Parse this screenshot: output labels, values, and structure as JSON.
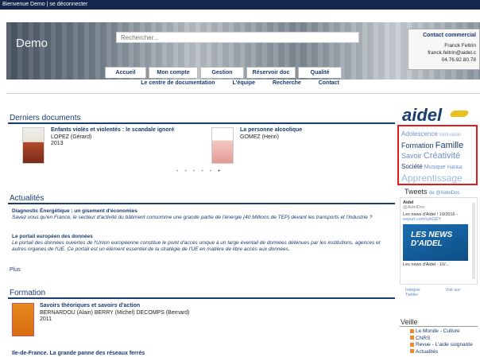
{
  "topbar": {
    "text": "Bienvenue Demo | se déconnecter"
  },
  "header": {
    "brand": "Demo",
    "search_placeholder": "Rechercher...",
    "contact": {
      "title": "Contact commercial",
      "name": "Franck Feltrin",
      "email": "franck.feltrin@aidel.c",
      "phone": "04.76.92.80.78"
    }
  },
  "nav": {
    "tabs": [
      "Accueil",
      "Mon compte",
      "Gestion",
      "Réservoir doc",
      "Qualité"
    ],
    "subnav": [
      "Le centre de documentation",
      "L'équipe",
      "Recherche",
      "Contact"
    ]
  },
  "derniers": {
    "title": "Derniers documents",
    "items": [
      {
        "title": "Enfants violés et violentés : le scandale ignoré",
        "author": "LOPEZ (Gérard)",
        "year": "2013"
      },
      {
        "title": "La personne alcoolique",
        "author": "GOMEZ (Henri)",
        "year": ""
      }
    ]
  },
  "actualites": {
    "title": "Actualités",
    "items": [
      {
        "title": "Diagnostic Énergétique : un gisement d'économies",
        "desc": "Savez vous qu'en France, le secteur d'activité du bâtiment consomme une grande partie de l'énergie (40 Millions de TEP) devant les transports et l'industrie ?"
      },
      {
        "title": "Le portail européen des données",
        "desc": "Le portail des données ouvertes de l'Union européenne constitue le point d'accès unique à un large éventail de données détenues par les institutions, agences et autres organes de l'UE. Ce portail est un élément essentiel de la stratégie de l'UE en matière de libre accès aux données."
      }
    ],
    "plus": "Plus"
  },
  "formation": {
    "title": "Formation",
    "items": [
      {
        "title": "Savoirs théoriques et savoirs d'action",
        "author": "BERNARDOU (Alain) BERRY (Michel) DECOMPS (Bernard)",
        "year": "2011"
      },
      {
        "title": "Ile-de-France. La grande panne des réseaux ferrés",
        "author": ""
      }
    ]
  },
  "sidebar": {
    "logo": "aidel",
    "tags": [
      [
        {
          "t": "Adolescence",
          "size": 8,
          "color": "#6a8fc8"
        },
        {
          "t": "Motivation",
          "size": 6,
          "color": "#9fb8dc"
        }
      ],
      [
        {
          "t": "Formation",
          "size": 9,
          "color": "#1a3c6e"
        },
        {
          "t": "Famille",
          "size": 11,
          "color": "#1a3c6e"
        }
      ],
      [
        {
          "t": "Savoir",
          "size": 9,
          "color": "#6a8fc8"
        },
        {
          "t": "Créativité",
          "size": 11,
          "color": "#6a8fc8"
        }
      ],
      [
        {
          "t": "Société",
          "size": 8,
          "color": "#1a3c6e"
        },
        {
          "t": "Musique",
          "size": 7,
          "color": "#6a8fc8"
        },
        {
          "t": "Habitat",
          "size": 6,
          "color": "#6a8fc8"
        }
      ],
      [
        {
          "t": "Apprentissage",
          "size": 12,
          "color": "#9fb8dc"
        }
      ]
    ],
    "tweets": {
      "title": "Tweets",
      "by": "de @AidelDoc",
      "account": "Aidel",
      "handle": "@AidelDoc",
      "text": "Les news d'Aidel ! 10/2016 -",
      "link": "eepurl.com/cjAGEY",
      "image_text": "LES NEWS D'AIDEL",
      "caption": "Les news d'Aidel - 10/...",
      "integrate": "Intégrer",
      "view": "Voir sur Twitter"
    },
    "veille": {
      "title": "Veille",
      "items": [
        "Le Monde - Culture",
        "CNRS",
        "Revue - L'aide soignante",
        "Actualités"
      ]
    }
  }
}
